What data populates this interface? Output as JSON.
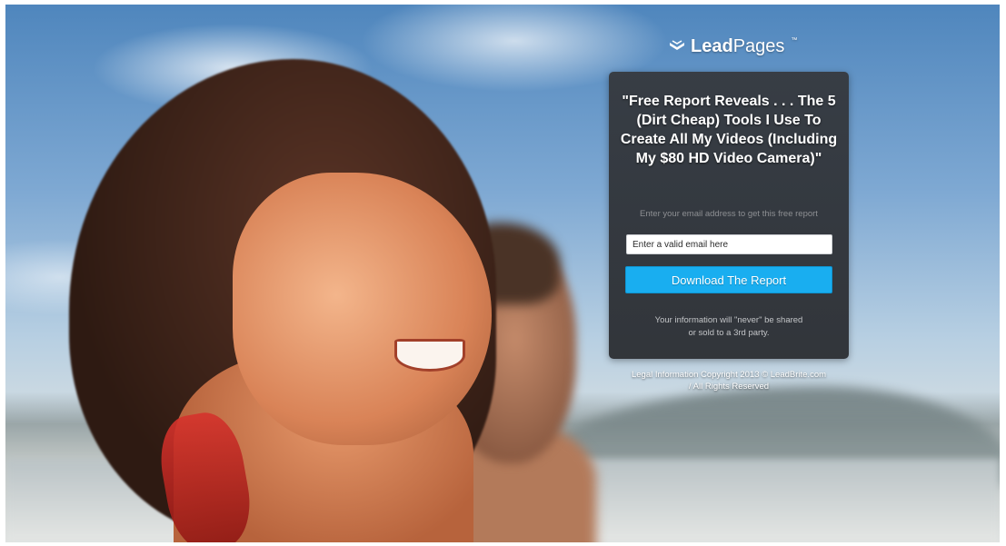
{
  "brand": {
    "name_bold": "Lead",
    "name_light": "Pages",
    "trademark": "™",
    "icon": "leadpages-logo-icon"
  },
  "optin": {
    "headline": "\"Free Report Reveals . . . The 5 (Dirt Cheap) Tools I Use To Create All My Videos (Including My $80 HD Video Camera)\"",
    "prompt": "Enter your email address to get this free report",
    "email_placeholder": "Enter a valid email here",
    "cta_label": "Download The Report",
    "privacy_line1": "Your information will \"never\" be shared",
    "privacy_line2": "or sold to a 3rd party."
  },
  "footer": {
    "legal_link": "Legal Information",
    "copyright": "Copyright 2013 © LeadBrite.com",
    "rights": "/ All Rights Reserved"
  },
  "colors": {
    "cta": "#19aef0",
    "card": "#303236"
  }
}
